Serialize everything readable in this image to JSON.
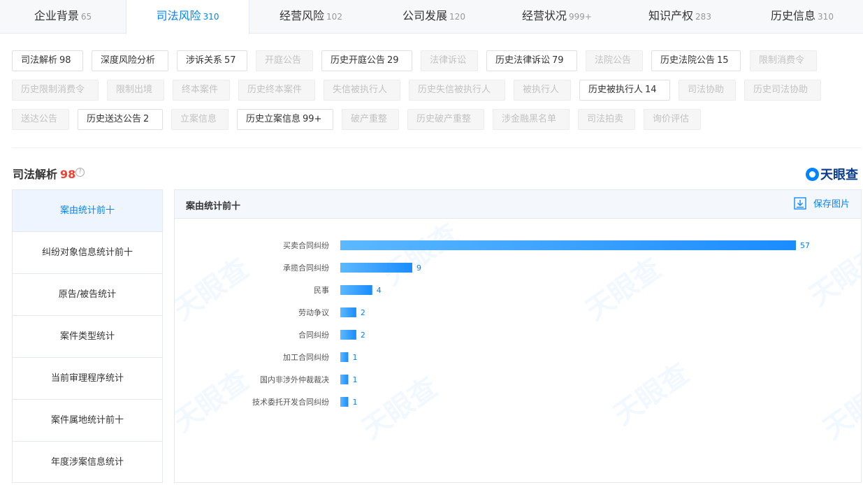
{
  "top_tabs": [
    {
      "label": "企业背景",
      "count": "65"
    },
    {
      "label": "司法风险",
      "count": "310"
    },
    {
      "label": "经营风险",
      "count": "102"
    },
    {
      "label": "公司发展",
      "count": "120"
    },
    {
      "label": "经营状况",
      "count": "999+"
    },
    {
      "label": "知识产权",
      "count": "283"
    },
    {
      "label": "历史信息",
      "count": "310"
    }
  ],
  "tags": [
    {
      "label": "司法解析",
      "count": "98"
    },
    {
      "label": "深度风险分析",
      "count": ""
    },
    {
      "label": "涉诉关系",
      "count": "57"
    },
    {
      "label": "开庭公告",
      "count": ""
    },
    {
      "label": "历史开庭公告",
      "count": "29"
    },
    {
      "label": "法律诉讼",
      "count": ""
    },
    {
      "label": "历史法律诉讼",
      "count": "79"
    },
    {
      "label": "法院公告",
      "count": ""
    },
    {
      "label": "历史法院公告",
      "count": "15"
    },
    {
      "label": "限制消费令",
      "count": ""
    },
    {
      "label": "历史限制消费令",
      "count": ""
    },
    {
      "label": "限制出境",
      "count": ""
    },
    {
      "label": "终本案件",
      "count": ""
    },
    {
      "label": "历史终本案件",
      "count": ""
    },
    {
      "label": "失信被执行人",
      "count": ""
    },
    {
      "label": "历史失信被执行人",
      "count": ""
    },
    {
      "label": "被执行人",
      "count": ""
    },
    {
      "label": "历史被执行人",
      "count": "14"
    },
    {
      "label": "司法协助",
      "count": ""
    },
    {
      "label": "历史司法协助",
      "count": ""
    },
    {
      "label": "送达公告",
      "count": ""
    },
    {
      "label": "历史送达公告",
      "count": "2"
    },
    {
      "label": "立案信息",
      "count": ""
    },
    {
      "label": "历史立案信息",
      "count": "99+"
    },
    {
      "label": "破产重整",
      "count": ""
    },
    {
      "label": "历史破产重整",
      "count": ""
    },
    {
      "label": "涉金融黑名单",
      "count": ""
    },
    {
      "label": "司法拍卖",
      "count": ""
    },
    {
      "label": "询价评估",
      "count": ""
    }
  ],
  "section": {
    "title": "司法解析",
    "count": "98",
    "help": "?"
  },
  "brand": {
    "name": "天眼查"
  },
  "left_menu": [
    {
      "label": "案由统计前十"
    },
    {
      "label": "纠纷对象信息统计前十"
    },
    {
      "label": "原告/被告统计"
    },
    {
      "label": "案件类型统计"
    },
    {
      "label": "当前审理程序统计"
    },
    {
      "label": "案件属地统计前十"
    },
    {
      "label": "年度涉案信息统计"
    }
  ],
  "panel": {
    "title": "案由统计前十",
    "save_label": "保存图片"
  },
  "watermark_text": "天眼查",
  "colors": {
    "accent": "#0084ff",
    "bar_light": "#5cb8ff",
    "bar_dark": "#1a8cff",
    "count_red": "#f04134"
  },
  "chart_data": {
    "type": "bar",
    "orientation": "horizontal",
    "categories": [
      "买卖合同纠纷",
      "承揽合同纠纷",
      "民事",
      "劳动争议",
      "合同纠纷",
      "加工合同纠纷",
      "国内非涉外仲裁裁决",
      "技术委托开发合同纠纷"
    ],
    "values": [
      57,
      9,
      4,
      2,
      2,
      1,
      1,
      1
    ],
    "title": "",
    "xlabel": "",
    "ylabel": "",
    "xlim": [
      0,
      57
    ],
    "grid": false,
    "data_labels": true
  }
}
